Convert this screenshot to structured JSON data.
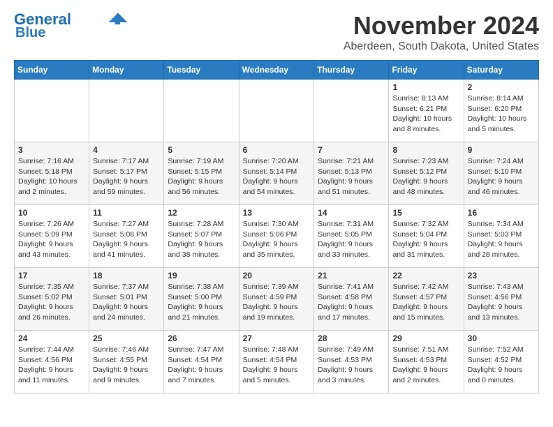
{
  "header": {
    "logo_line1": "General",
    "logo_line2": "Blue",
    "month": "November 2024",
    "location": "Aberdeen, South Dakota, United States"
  },
  "weekdays": [
    "Sunday",
    "Monday",
    "Tuesday",
    "Wednesday",
    "Thursday",
    "Friday",
    "Saturday"
  ],
  "weeks": [
    [
      {
        "day": "",
        "info": ""
      },
      {
        "day": "",
        "info": ""
      },
      {
        "day": "",
        "info": ""
      },
      {
        "day": "",
        "info": ""
      },
      {
        "day": "",
        "info": ""
      },
      {
        "day": "1",
        "info": "Sunrise: 8:13 AM\nSunset: 6:21 PM\nDaylight: 10 hours\nand 8 minutes."
      },
      {
        "day": "2",
        "info": "Sunrise: 8:14 AM\nSunset: 6:20 PM\nDaylight: 10 hours\nand 5 minutes."
      }
    ],
    [
      {
        "day": "3",
        "info": "Sunrise: 7:16 AM\nSunset: 5:18 PM\nDaylight: 10 hours\nand 2 minutes."
      },
      {
        "day": "4",
        "info": "Sunrise: 7:17 AM\nSunset: 5:17 PM\nDaylight: 9 hours\nand 59 minutes."
      },
      {
        "day": "5",
        "info": "Sunrise: 7:19 AM\nSunset: 5:15 PM\nDaylight: 9 hours\nand 56 minutes."
      },
      {
        "day": "6",
        "info": "Sunrise: 7:20 AM\nSunset: 5:14 PM\nDaylight: 9 hours\nand 54 minutes."
      },
      {
        "day": "7",
        "info": "Sunrise: 7:21 AM\nSunset: 5:13 PM\nDaylight: 9 hours\nand 51 minutes."
      },
      {
        "day": "8",
        "info": "Sunrise: 7:23 AM\nSunset: 5:12 PM\nDaylight: 9 hours\nand 48 minutes."
      },
      {
        "day": "9",
        "info": "Sunrise: 7:24 AM\nSunset: 5:10 PM\nDaylight: 9 hours\nand 46 minutes."
      }
    ],
    [
      {
        "day": "10",
        "info": "Sunrise: 7:26 AM\nSunset: 5:09 PM\nDaylight: 9 hours\nand 43 minutes."
      },
      {
        "day": "11",
        "info": "Sunrise: 7:27 AM\nSunset: 5:08 PM\nDaylight: 9 hours\nand 41 minutes."
      },
      {
        "day": "12",
        "info": "Sunrise: 7:28 AM\nSunset: 5:07 PM\nDaylight: 9 hours\nand 38 minutes."
      },
      {
        "day": "13",
        "info": "Sunrise: 7:30 AM\nSunset: 5:06 PM\nDaylight: 9 hours\nand 35 minutes."
      },
      {
        "day": "14",
        "info": "Sunrise: 7:31 AM\nSunset: 5:05 PM\nDaylight: 9 hours\nand 33 minutes."
      },
      {
        "day": "15",
        "info": "Sunrise: 7:32 AM\nSunset: 5:04 PM\nDaylight: 9 hours\nand 31 minutes."
      },
      {
        "day": "16",
        "info": "Sunrise: 7:34 AM\nSunset: 5:03 PM\nDaylight: 9 hours\nand 28 minutes."
      }
    ],
    [
      {
        "day": "17",
        "info": "Sunrise: 7:35 AM\nSunset: 5:02 PM\nDaylight: 9 hours\nand 26 minutes."
      },
      {
        "day": "18",
        "info": "Sunrise: 7:37 AM\nSunset: 5:01 PM\nDaylight: 9 hours\nand 24 minutes."
      },
      {
        "day": "19",
        "info": "Sunrise: 7:38 AM\nSunset: 5:00 PM\nDaylight: 9 hours\nand 21 minutes."
      },
      {
        "day": "20",
        "info": "Sunrise: 7:39 AM\nSunset: 4:59 PM\nDaylight: 9 hours\nand 19 minutes."
      },
      {
        "day": "21",
        "info": "Sunrise: 7:41 AM\nSunset: 4:58 PM\nDaylight: 9 hours\nand 17 minutes."
      },
      {
        "day": "22",
        "info": "Sunrise: 7:42 AM\nSunset: 4:57 PM\nDaylight: 9 hours\nand 15 minutes."
      },
      {
        "day": "23",
        "info": "Sunrise: 7:43 AM\nSunset: 4:56 PM\nDaylight: 9 hours\nand 13 minutes."
      }
    ],
    [
      {
        "day": "24",
        "info": "Sunrise: 7:44 AM\nSunset: 4:56 PM\nDaylight: 9 hours\nand 11 minutes."
      },
      {
        "day": "25",
        "info": "Sunrise: 7:46 AM\nSunset: 4:55 PM\nDaylight: 9 hours\nand 9 minutes."
      },
      {
        "day": "26",
        "info": "Sunrise: 7:47 AM\nSunset: 4:54 PM\nDaylight: 9 hours\nand 7 minutes."
      },
      {
        "day": "27",
        "info": "Sunrise: 7:48 AM\nSunset: 4:54 PM\nDaylight: 9 hours\nand 5 minutes."
      },
      {
        "day": "28",
        "info": "Sunrise: 7:49 AM\nSunset: 4:53 PM\nDaylight: 9 hours\nand 3 minutes."
      },
      {
        "day": "29",
        "info": "Sunrise: 7:51 AM\nSunset: 4:53 PM\nDaylight: 9 hours\nand 2 minutes."
      },
      {
        "day": "30",
        "info": "Sunrise: 7:52 AM\nSunset: 4:52 PM\nDaylight: 9 hours\nand 0 minutes."
      }
    ]
  ]
}
